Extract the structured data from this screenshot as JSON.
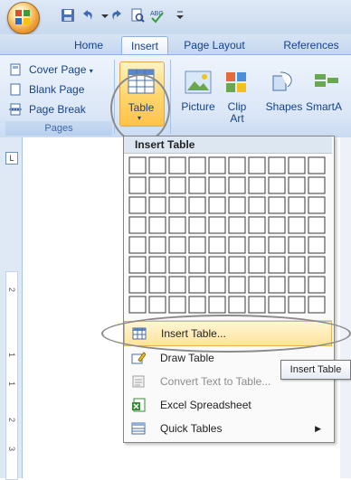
{
  "tabs": [
    "Home",
    "Insert",
    "Page Layout",
    "References"
  ],
  "pages_group": {
    "items": [
      "Cover Page",
      "Blank Page",
      "Page Break"
    ],
    "label": "Pages"
  },
  "ribbon": {
    "table": "Table",
    "picture": "Picture",
    "clip_art_1": "Clip",
    "clip_art_2": "Art",
    "shapes": "Shapes",
    "smartart": "SmartA"
  },
  "ruler": {
    "corner": "L",
    "numbers": [
      "2",
      "1",
      "1",
      "2",
      "3"
    ]
  },
  "dropdown": {
    "header": "Insert Table",
    "grid": {
      "columns": 10,
      "rows": 8
    },
    "items": [
      {
        "label": "Insert Table...",
        "disabled": false,
        "icon": "table-icon"
      },
      {
        "label": "Draw Table",
        "disabled": false,
        "icon": "pencil-icon"
      },
      {
        "label": "Convert Text to Table...",
        "disabled": true,
        "icon": "convert-icon"
      },
      {
        "label": "Excel Spreadsheet",
        "disabled": false,
        "icon": "excel-icon"
      },
      {
        "label": "Quick Tables",
        "disabled": false,
        "icon": "quick-tables-icon"
      }
    ]
  },
  "tooltip": "Insert Table",
  "colors": {
    "ribbon_text": "#15428b",
    "highlight": "#ffd56a",
    "menu_bg": "#fafafa"
  }
}
